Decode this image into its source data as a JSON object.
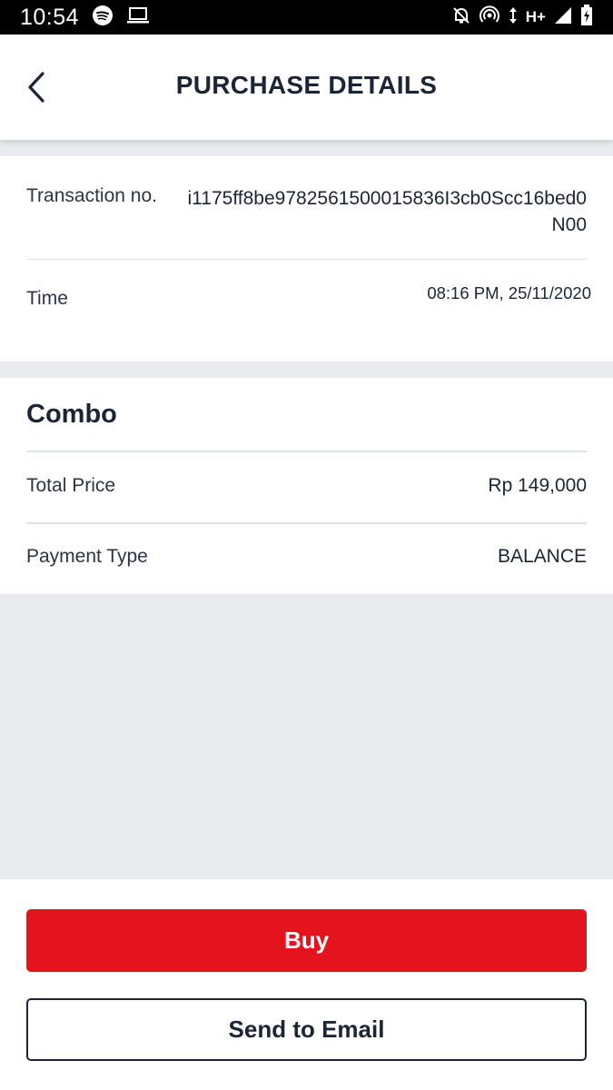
{
  "status_bar": {
    "time": "10:54",
    "network": "H+",
    "icons": [
      "spotify-icon",
      "laptop-icon",
      "notifications-off-icon",
      "hotspot-icon",
      "data-arrows-icon",
      "signal-icon",
      "battery-icon"
    ]
  },
  "header": {
    "title": "PURCHASE DETAILS",
    "back_icon": "chevron-left-icon"
  },
  "transaction": {
    "number_label": "Transaction no.",
    "number_value": "i1175ff8be9782561500015836I3cb0Scc16bed0N00",
    "time_label": "Time",
    "time_value": "08:16 PM, 25/11/2020"
  },
  "package": {
    "title": "Combo",
    "total_price_label": "Total Price",
    "total_price_value": "Rp 149,000",
    "payment_type_label": "Payment Type",
    "payment_type_value": "BALANCE"
  },
  "actions": {
    "buy_label": "Buy",
    "email_label": "Send to Email"
  },
  "colors": {
    "accent_red": "#e4141f",
    "text_dark": "#1c2536",
    "page_bg": "#e9ebee"
  }
}
